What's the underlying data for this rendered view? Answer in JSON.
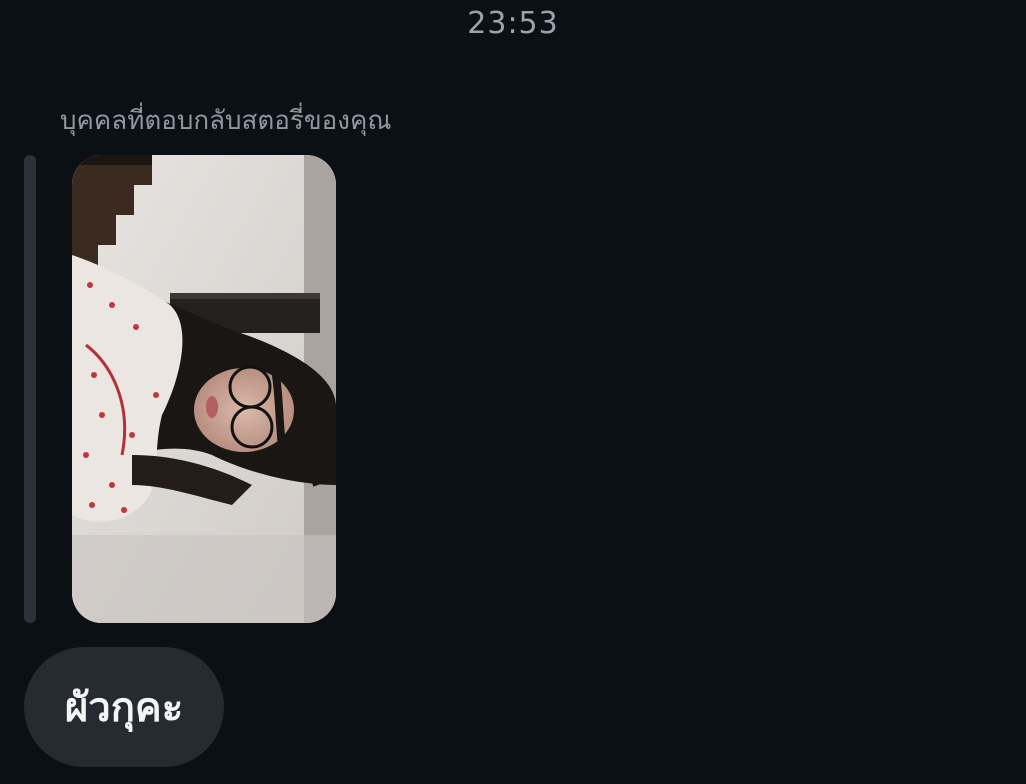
{
  "conversation": {
    "timestamp": "23:53",
    "story_reply_label": "บุคคลที่ตอบกลับสตอรี่ของคุณ",
    "story_thumbnail": {
      "description_icon": "story-photo-thumbnail"
    },
    "message": {
      "text": "ผัวกุคะ"
    }
  },
  "colors": {
    "background": "#0b1015",
    "bubble": "#262b31",
    "quote_bar": "#2c3239",
    "secondary_text": "#8f98a2"
  }
}
